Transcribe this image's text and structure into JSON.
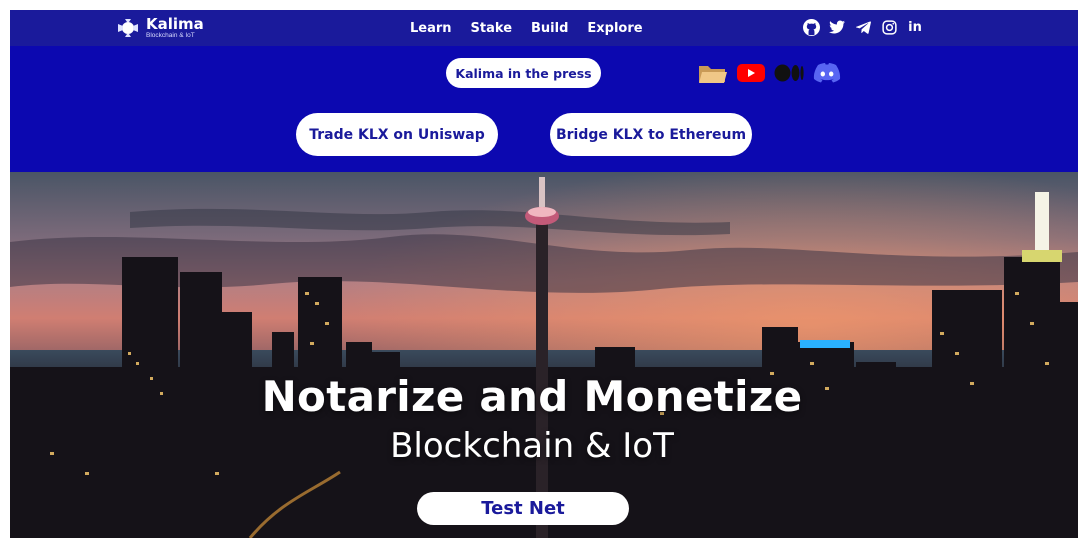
{
  "nav": {
    "brand_name": "Kalima",
    "brand_tagline": "Blockchain & IoT",
    "menu": [
      "Learn",
      "Stake",
      "Build",
      "Explore"
    ],
    "social_icons": [
      "github-icon",
      "twitter-icon",
      "telegram-icon",
      "instagram-icon",
      "linkedin-icon"
    ],
    "linkedin_label": "in"
  },
  "banner": {
    "press_label": "Kalima in the press",
    "press_icons": [
      "folder-icon",
      "youtube-icon",
      "medium-icon",
      "discord-icon"
    ],
    "trade_label": "Trade KLX on Uniswap",
    "bridge_label": "Bridge KLX to Ethereum"
  },
  "hero": {
    "title": "Notarize and Monetize",
    "subtitle": "Blockchain & IoT",
    "cta_label": "Test Net"
  },
  "colors": {
    "nav_bg": "#1a1a9b",
    "banner_bg": "#0c08b0",
    "button_text": "#1a1a9b",
    "youtube_red": "#ff0000",
    "discord_blue": "#5865f2"
  }
}
